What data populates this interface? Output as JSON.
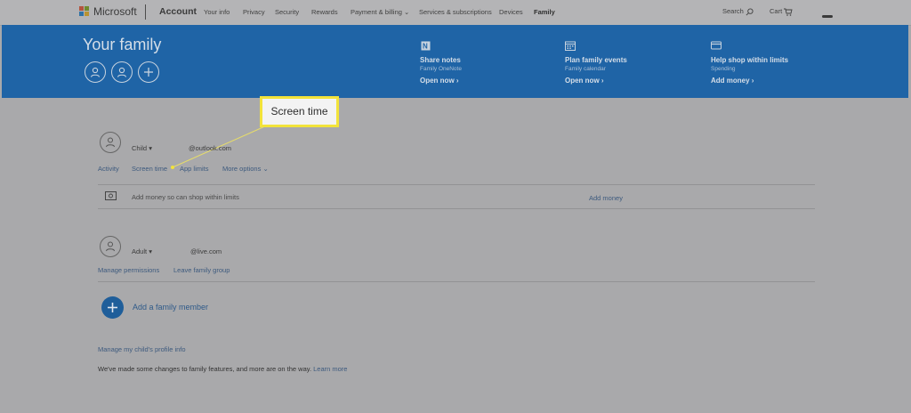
{
  "nav": {
    "brand": "Microsoft",
    "account": "Account",
    "links": [
      "Your info",
      "Privacy",
      "Security",
      "Rewards",
      "Payment & billing",
      "Services & subscriptions",
      "Devices",
      "Family"
    ],
    "search_label": "Search",
    "cart_label": "Cart"
  },
  "banner": {
    "title": "Your family",
    "features": [
      {
        "title": "Share notes",
        "subtitle": "Family OneNote",
        "link": "Open now"
      },
      {
        "title": "Plan family events",
        "subtitle": "Family calendar",
        "link": "Open now"
      },
      {
        "title": "Help          shop within limits",
        "subtitle": "Spending",
        "link": "Add money"
      }
    ],
    "icons": [
      "onenote-icon",
      "calendar-icon",
      "card-icon"
    ]
  },
  "callout": {
    "text": "Screen time"
  },
  "child": {
    "role": "Child",
    "email": "@outlook.com",
    "tabs": [
      "Activity",
      "Screen time",
      "App limits",
      "More options"
    ],
    "money_text": "Add money so            can shop within limits",
    "money_link": "Add money"
  },
  "adult": {
    "role": "Adult",
    "email": "@live.com",
    "actions": [
      "Manage permissions",
      "Leave family group"
    ]
  },
  "add_member": {
    "label": "Add a family member"
  },
  "profile_link": "Manage my child's profile info",
  "footer": {
    "text": "We've made some changes to family features, and more are on the way.",
    "link": "Learn more"
  },
  "colors": {
    "banner": "#1f64a6",
    "callout_border": "#f2e33a",
    "overlay_bg": "#a9a9ab"
  }
}
